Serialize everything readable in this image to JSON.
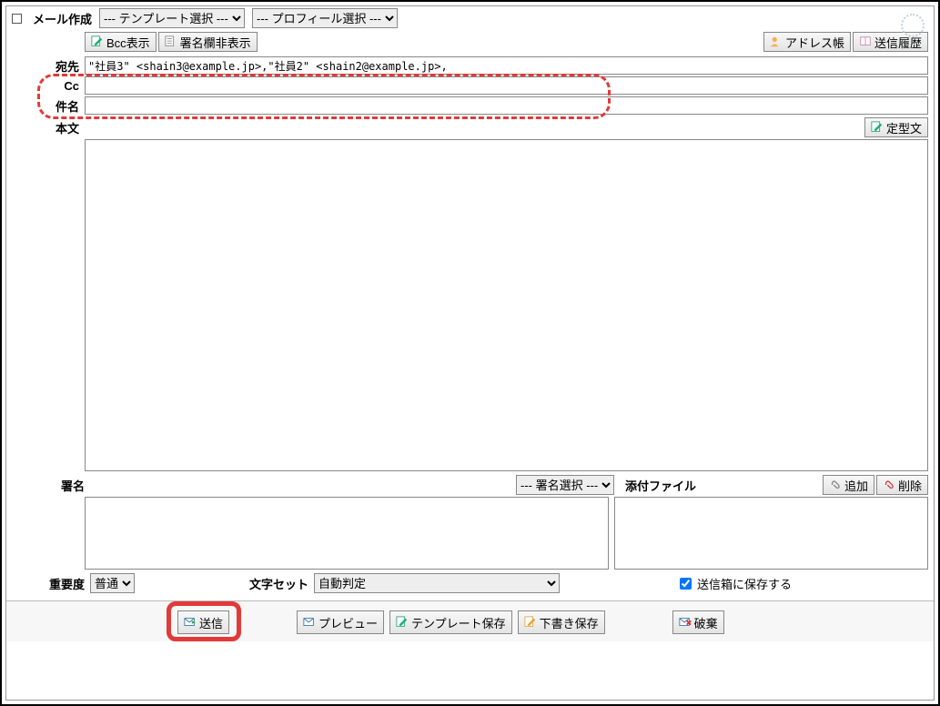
{
  "header": {
    "title": "メール作成",
    "template_select": "--- テンプレート選択 ---",
    "profile_select": "--- プロフィール選択 ---"
  },
  "toolbar": {
    "bcc_show": "Bcc表示",
    "sig_hide": "署名欄非表示",
    "address_book": "アドレス帳",
    "send_history": "送信履歴"
  },
  "fields": {
    "to_label": "宛先",
    "to_value": "\"社員3\" <shain3@example.jp>,\"社員2\" <shain2@example.jp>,",
    "cc_label": "Cc",
    "cc_value": "",
    "subject_label": "件名",
    "subject_value": "",
    "body_label": "本文",
    "boilerplate_btn": "定型文",
    "body_value": ""
  },
  "signature": {
    "label": "署名",
    "select_value": "--- 署名選択 ---"
  },
  "attachment": {
    "label": "添付ファイル",
    "add_btn": "追加",
    "delete_btn": "削除"
  },
  "options": {
    "importance_label": "重要度",
    "importance_value": "普通",
    "charset_label": "文字セット",
    "charset_value": "自動判定",
    "save_to_sent_label": "送信箱に保存する",
    "save_to_sent_checked": true
  },
  "actions": {
    "send": "送信",
    "preview": "プレビュー",
    "save_template": "テンプレート保存",
    "save_draft": "下書き保存",
    "discard": "破棄"
  }
}
